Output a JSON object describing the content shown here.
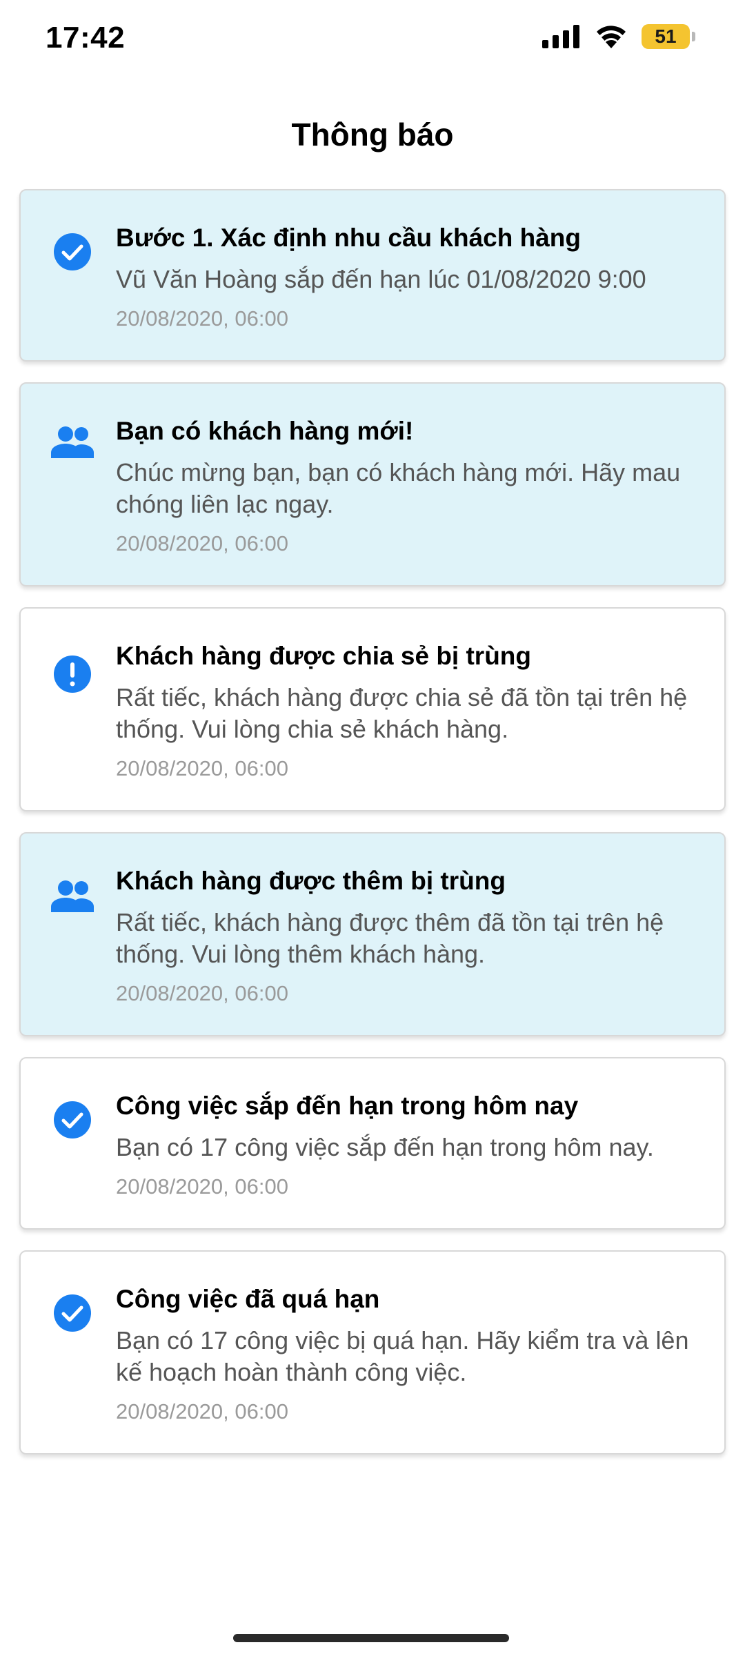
{
  "status_bar": {
    "time": "17:42",
    "battery_level": "51",
    "battery_color": "#f4c430"
  },
  "header": {
    "title": "Thông báo"
  },
  "colors": {
    "accent": "#1a7ff0",
    "unread_bg": "#dff3f9",
    "read_bg": "#ffffff"
  },
  "notifications": [
    {
      "icon": "check-circle-icon",
      "unread": true,
      "title": "Bước 1. Xác định nhu cầu khách hàng",
      "message": "Vũ Văn Hoàng sắp đến hạn lúc 01/08/2020 9:00",
      "time": "20/08/2020, 06:00"
    },
    {
      "icon": "people-icon",
      "unread": true,
      "title": "Bạn có khách hàng mới!",
      "message": "Chúc mừng bạn, bạn có khách hàng mới. Hãy mau chóng liên lạc ngay.",
      "time": "20/08/2020, 06:00"
    },
    {
      "icon": "exclamation-circle-icon",
      "unread": false,
      "title": "Khách hàng được chia sẻ bị trùng",
      "message": "Rất tiếc, khách hàng được chia sẻ đã tồn tại trên hệ thống. Vui lòng chia sẻ khách hàng.",
      "time": "20/08/2020, 06:00"
    },
    {
      "icon": "people-icon",
      "unread": true,
      "title": "Khách hàng được thêm bị trùng",
      "message": "Rất tiếc, khách hàng được thêm đã tồn tại trên hệ thống. Vui lòng thêm khách hàng.",
      "time": "20/08/2020, 06:00"
    },
    {
      "icon": "check-circle-icon",
      "unread": false,
      "title": "Công việc sắp đến hạn trong hôm nay",
      "message": "Bạn có 17 công việc sắp đến hạn trong hôm nay.",
      "time": "20/08/2020, 06:00"
    },
    {
      "icon": "check-circle-icon",
      "unread": false,
      "title": "Công việc đã quá hạn",
      "message": "Bạn có 17 công việc bị quá hạn. Hãy kiểm tra và lên kế hoạch hoàn thành công việc.",
      "time": "20/08/2020, 06:00"
    }
  ]
}
